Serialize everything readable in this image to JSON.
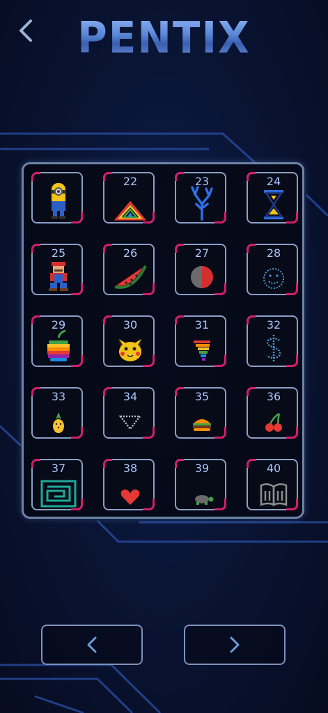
{
  "title": "PENTIX",
  "levels": [
    {
      "number": "",
      "icon": "minion-icon"
    },
    {
      "number": "22",
      "icon": "rainbow-triangle-icon"
    },
    {
      "number": "23",
      "icon": "coral-tree-icon"
    },
    {
      "number": "24",
      "icon": "hourglass-icon"
    },
    {
      "number": "25",
      "icon": "mario-icon"
    },
    {
      "number": "26",
      "icon": "watermelon-icon"
    },
    {
      "number": "27",
      "icon": "red-ball-icon"
    },
    {
      "number": "28",
      "icon": "smiley-outline-icon"
    },
    {
      "number": "29",
      "icon": "rainbow-apple-icon"
    },
    {
      "number": "30",
      "icon": "pikachu-icon"
    },
    {
      "number": "31",
      "icon": "tornado-icon"
    },
    {
      "number": "32",
      "icon": "dollar-sign-icon"
    },
    {
      "number": "33",
      "icon": "pineapple-icon"
    },
    {
      "number": "34",
      "icon": "diamond-icon"
    },
    {
      "number": "35",
      "icon": "burger-icon"
    },
    {
      "number": "36",
      "icon": "cherries-icon"
    },
    {
      "number": "37",
      "icon": "maze-icon"
    },
    {
      "number": "38",
      "icon": "heart-icon"
    },
    {
      "number": "39",
      "icon": "turtle-icon"
    },
    {
      "number": "40",
      "icon": "open-book-icon"
    }
  ],
  "colors": {
    "accent": "#d21e6a",
    "tile_border": "#8aa0c8",
    "number": "#a9c6ff"
  }
}
